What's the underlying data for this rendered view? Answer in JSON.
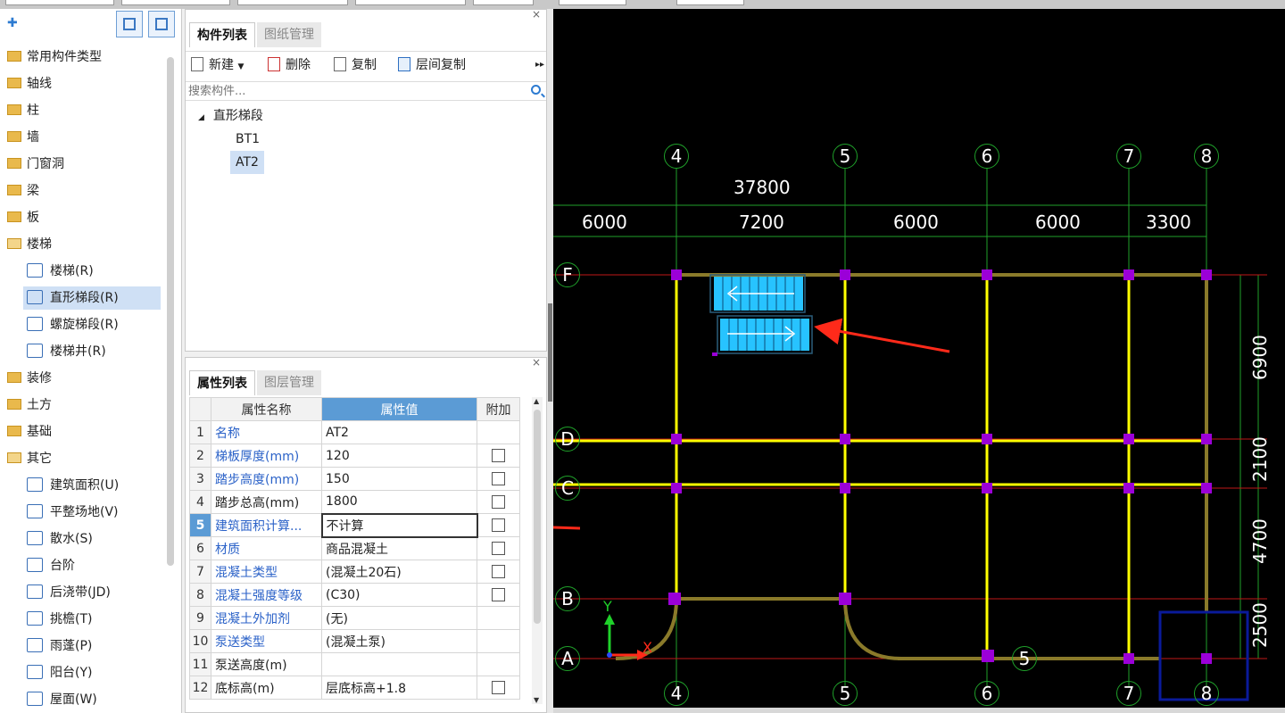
{
  "left_tree": {
    "items": [
      {
        "label": "常用构件类型",
        "type": "folder"
      },
      {
        "label": "轴线",
        "type": "folder"
      },
      {
        "label": "柱",
        "type": "folder"
      },
      {
        "label": "墙",
        "type": "folder"
      },
      {
        "label": "门窗洞",
        "type": "folder"
      },
      {
        "label": "梁",
        "type": "folder"
      },
      {
        "label": "板",
        "type": "folder"
      },
      {
        "label": "楼梯",
        "type": "folder-open"
      },
      {
        "label": "楼梯(R)",
        "type": "sub"
      },
      {
        "label": "直形梯段(R)",
        "type": "sub",
        "selected": true
      },
      {
        "label": "螺旋梯段(R)",
        "type": "sub"
      },
      {
        "label": "楼梯井(R)",
        "type": "sub"
      },
      {
        "label": "装修",
        "type": "folder"
      },
      {
        "label": "土方",
        "type": "folder"
      },
      {
        "label": "基础",
        "type": "folder"
      },
      {
        "label": "其它",
        "type": "folder-open"
      },
      {
        "label": "建筑面积(U)",
        "type": "sub"
      },
      {
        "label": "平整场地(V)",
        "type": "sub"
      },
      {
        "label": "散水(S)",
        "type": "sub"
      },
      {
        "label": "台阶",
        "type": "sub"
      },
      {
        "label": "后浇带(JD)",
        "type": "sub"
      },
      {
        "label": "挑檐(T)",
        "type": "sub"
      },
      {
        "label": "雨蓬(P)",
        "type": "sub"
      },
      {
        "label": "阳台(Y)",
        "type": "sub"
      },
      {
        "label": "屋面(W)",
        "type": "sub"
      }
    ]
  },
  "component_panel": {
    "tab_active": "构件列表",
    "tab_inactive": "图纸管理",
    "toolbar": {
      "new": "新建",
      "delete": "删除",
      "copy": "复制",
      "floor_copy": "层间复制"
    },
    "search_placeholder": "搜索构件...",
    "tree_root": "直形梯段",
    "tree_children": [
      "BT1",
      "AT2"
    ]
  },
  "property_panel": {
    "tab_active": "属性列表",
    "tab_inactive": "图层管理",
    "headers": {
      "name": "属性名称",
      "value": "属性值",
      "extra": "附加"
    },
    "rows": [
      {
        "num": "1",
        "name": "名称",
        "value": "AT2",
        "blue": true,
        "cb": false
      },
      {
        "num": "2",
        "name": "梯板厚度(mm)",
        "value": "120",
        "blue": true,
        "cb": true
      },
      {
        "num": "3",
        "name": "踏步高度(mm)",
        "value": "150",
        "blue": true,
        "cb": true
      },
      {
        "num": "4",
        "name": "踏步总高(mm)",
        "value": "1800",
        "blue": false,
        "cb": true
      },
      {
        "num": "5",
        "name": "建筑面积计算...",
        "value": "不计算",
        "blue": true,
        "cb": true,
        "highlight": true
      },
      {
        "num": "6",
        "name": "材质",
        "value": "商品混凝土",
        "blue": true,
        "cb": true
      },
      {
        "num": "7",
        "name": "混凝土类型",
        "value": "(混凝土20石)",
        "blue": true,
        "cb": true
      },
      {
        "num": "8",
        "name": "混凝土强度等级",
        "value": "(C30)",
        "blue": true,
        "cb": true
      },
      {
        "num": "9",
        "name": "混凝土外加剂",
        "value": "(无)",
        "blue": true,
        "cb": false
      },
      {
        "num": "10",
        "name": "泵送类型",
        "value": "(混凝土泵)",
        "blue": true,
        "cb": false
      },
      {
        "num": "11",
        "name": "泵送高度(m)",
        "value": "",
        "blue": false,
        "cb": false
      },
      {
        "num": "12",
        "name": "底标高(m)",
        "value": "层底标高+1.8",
        "blue": false,
        "cb": true
      }
    ]
  },
  "cad": {
    "axis_top": [
      "4",
      "5",
      "6",
      "7",
      "8"
    ],
    "axis_bottom": [
      "4",
      "5",
      "6",
      "7",
      "8"
    ],
    "axis_left": [
      "F",
      "D",
      "C",
      "B",
      "A"
    ],
    "total_dim": "37800",
    "dims_top": [
      "6000",
      "7200",
      "6000",
      "6000",
      "3300"
    ],
    "dims_right": [
      "6900",
      "2100",
      "4700",
      "2500"
    ],
    "mid_label": "5",
    "ucs_x": "X",
    "ucs_y": "Y",
    "colors": {
      "grid": "#1fa02a",
      "beam": "#ffff00",
      "column": "#9b00d8",
      "stair": "#27c3ff",
      "arrow": "#ff2a1a"
    }
  }
}
